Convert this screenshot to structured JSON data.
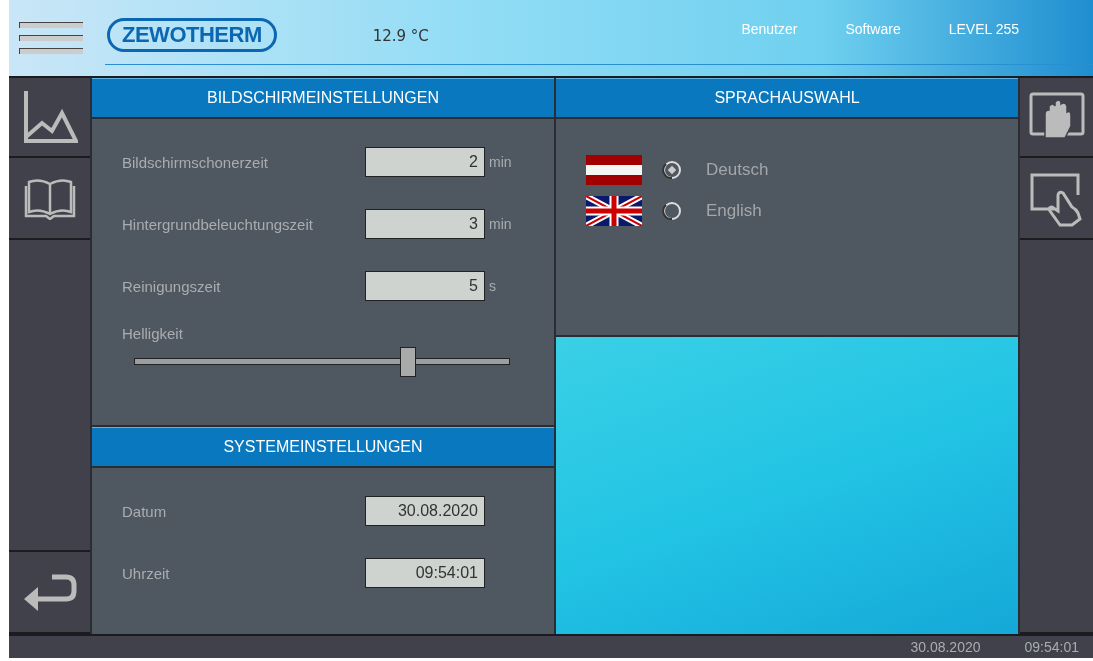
{
  "header": {
    "logo": "ZEWOTHERM",
    "temperature": "12.9 °C",
    "links": [
      "Benutzer",
      "Software",
      "LEVEL 255"
    ]
  },
  "screen_settings": {
    "title": "BILDSCHIRMEINSTELLUNGEN",
    "fields": [
      {
        "label": "Bildschirmschonerzeit",
        "value": "2",
        "unit": "min"
      },
      {
        "label": "Hintergrundbeleuchtungszeit",
        "value": "3",
        "unit": "min"
      },
      {
        "label": "Reinigungszeit",
        "value": "5",
        "unit": "s"
      }
    ],
    "brightness": {
      "label": "Helligkeit",
      "level": 0.73
    }
  },
  "system_settings": {
    "title": "SYSTEMEINSTELLUNGEN",
    "fields": [
      {
        "label": "Datum",
        "value": "30.08.2020"
      },
      {
        "label": "Uhrzeit",
        "value": "09:54:01"
      }
    ]
  },
  "language": {
    "title": "SPRACHAUSWAHL",
    "options": [
      {
        "label": "Deutsch",
        "kind": "austria",
        "selected": true
      },
      {
        "label": "English",
        "kind": "uk",
        "selected": false
      }
    ]
  },
  "status_bar": {
    "date": "30.08.2020",
    "time": "09:54:01"
  }
}
